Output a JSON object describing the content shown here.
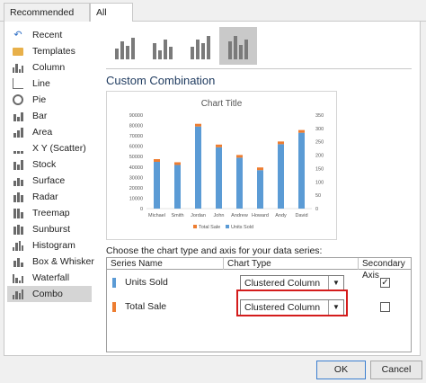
{
  "tabs": [
    "Recommended Charts",
    "All Charts"
  ],
  "sidebar": [
    {
      "label": "Recent",
      "icon": "recent-icon"
    },
    {
      "label": "Templates",
      "icon": "folder-icon"
    },
    {
      "label": "Column",
      "icon": "column-chart-icon"
    },
    {
      "label": "Line",
      "icon": "line-chart-icon"
    },
    {
      "label": "Pie",
      "icon": "pie-chart-icon"
    },
    {
      "label": "Bar",
      "icon": "bar-chart-icon"
    },
    {
      "label": "Area",
      "icon": "area-chart-icon"
    },
    {
      "label": "X Y (Scatter)",
      "icon": "scatter-chart-icon"
    },
    {
      "label": "Stock",
      "icon": "stock-chart-icon"
    },
    {
      "label": "Surface",
      "icon": "surface-chart-icon"
    },
    {
      "label": "Radar",
      "icon": "radar-chart-icon"
    },
    {
      "label": "Treemap",
      "icon": "treemap-chart-icon"
    },
    {
      "label": "Sunburst",
      "icon": "sunburst-chart-icon"
    },
    {
      "label": "Histogram",
      "icon": "histogram-chart-icon"
    },
    {
      "label": "Box & Whisker",
      "icon": "box-whisker-chart-icon"
    },
    {
      "label": "Waterfall",
      "icon": "waterfall-chart-icon"
    },
    {
      "label": "Combo",
      "icon": "combo-chart-icon",
      "selected": true
    }
  ],
  "combo_types": [
    {
      "icon": "clustered-column-line-icon"
    },
    {
      "icon": "clustered-column-line-secondary-icon"
    },
    {
      "icon": "stacked-area-column-icon"
    },
    {
      "icon": "custom-combination-icon",
      "selected": true
    }
  ],
  "heading": "Custom Combination",
  "prompt": "Choose the chart type and axis for your data series:",
  "table": {
    "headers": {
      "series": "Series Name",
      "type": "Chart Type",
      "axis": "Secondary Axis"
    },
    "rows": [
      {
        "name": "Units Sold",
        "type": "Clustered Column",
        "secondary": true,
        "color": "#5b9bd5"
      },
      {
        "name": "Total Sale",
        "type": "Clustered Column",
        "secondary": false,
        "color": "#ed7d31"
      }
    ]
  },
  "buttons": {
    "ok": "OK",
    "cancel": "Cancel"
  },
  "chart_data": {
    "type": "bar",
    "title": "Chart Title",
    "categories": [
      "Michael",
      "Smith",
      "Jordan",
      "John",
      "Andrew",
      "Howard",
      "Andy",
      "David"
    ],
    "series": [
      {
        "name": "Units Sold",
        "values": [
          45000,
          42000,
          79000,
          59000,
          49000,
          37000,
          62000,
          73000
        ],
        "color": "#5b9bd5",
        "axis": "primary"
      },
      {
        "name": "Total Sale",
        "values": [
          47,
          44,
          84,
          61,
          51,
          39,
          66,
          77
        ],
        "color": "#ed7d31",
        "axis": "secondary"
      }
    ],
    "y_ticks": [
      "0",
      "10000",
      "20000",
      "30000",
      "40000",
      "50000",
      "60000",
      "70000",
      "80000",
      "90000"
    ],
    "y2_ticks": [
      "0",
      "50",
      "100",
      "150",
      "200",
      "250",
      "300",
      "350"
    ],
    "ylim": [
      0,
      90000
    ],
    "y2lim": [
      0,
      350
    ],
    "stacked_display": true,
    "legend": "bottom",
    "legend_labels": [
      "Total Sale",
      "Units Sold"
    ]
  }
}
